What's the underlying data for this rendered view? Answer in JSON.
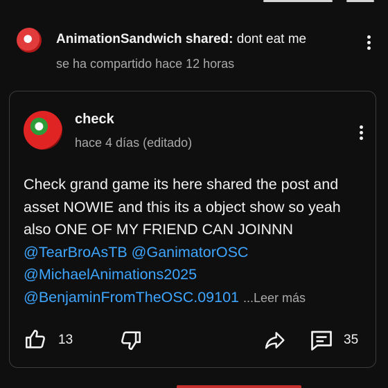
{
  "share": {
    "author": "AnimationSandwich shared:",
    "title": "dont eat me",
    "time": "se ha compartido hace 12 horas"
  },
  "post": {
    "author": "check",
    "time": "hace 4 días (editado)",
    "text_main": "Check grand game its here shared the post and asset NOWIE and this its a object show so yeah also ONE OF MY FRIEND CAN JOINNN ",
    "mentions": [
      "@TearBroAsTB",
      "@GanimatorOSC",
      "@MichaelAnimations2025",
      "@BenjaminFromTheOSC.09101"
    ],
    "read_more": "...Leer más"
  },
  "actions": {
    "like_count": "13",
    "comment_count": "35"
  },
  "icons": {
    "like": "thumbs-up-icon",
    "dislike": "thumbs-down-icon",
    "share": "share-arrow-icon",
    "comment": "comment-icon",
    "more": "more-vert-icon"
  },
  "colors": {
    "background": "#0f0f0f",
    "text": "#f1f1f1",
    "secondary_text": "#aaaaaa",
    "mention": "#3ea6ff",
    "card_border": "#3d3d3d"
  }
}
